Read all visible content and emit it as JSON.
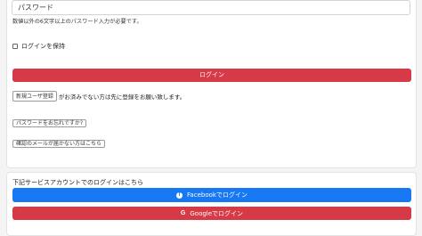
{
  "form": {
    "password_placeholder": "パスワード",
    "password_hint": "数値以外の6文字以上のパスワード入力が必要です。",
    "remember_label": "ログインを保持",
    "login_button": "ログイン",
    "register_button": "新規ユーザ登録",
    "register_text": "がお済みでない方は先に登録をお願い致します。",
    "forgot_password_button": "パスワードをお忘れですか?",
    "resend_confirmation_button": "確認のメールが届かない方はこちら"
  },
  "social": {
    "title": "下記サービスアカウントでのログインはこちら",
    "facebook_button": "Facebookでログイン",
    "google_button": "Googleでログイン",
    "facebook_icon": "f",
    "google_icon": "G"
  },
  "colors": {
    "login_button": "#d63a46",
    "facebook_button": "#1877f2",
    "google_button": "#d63a46"
  }
}
